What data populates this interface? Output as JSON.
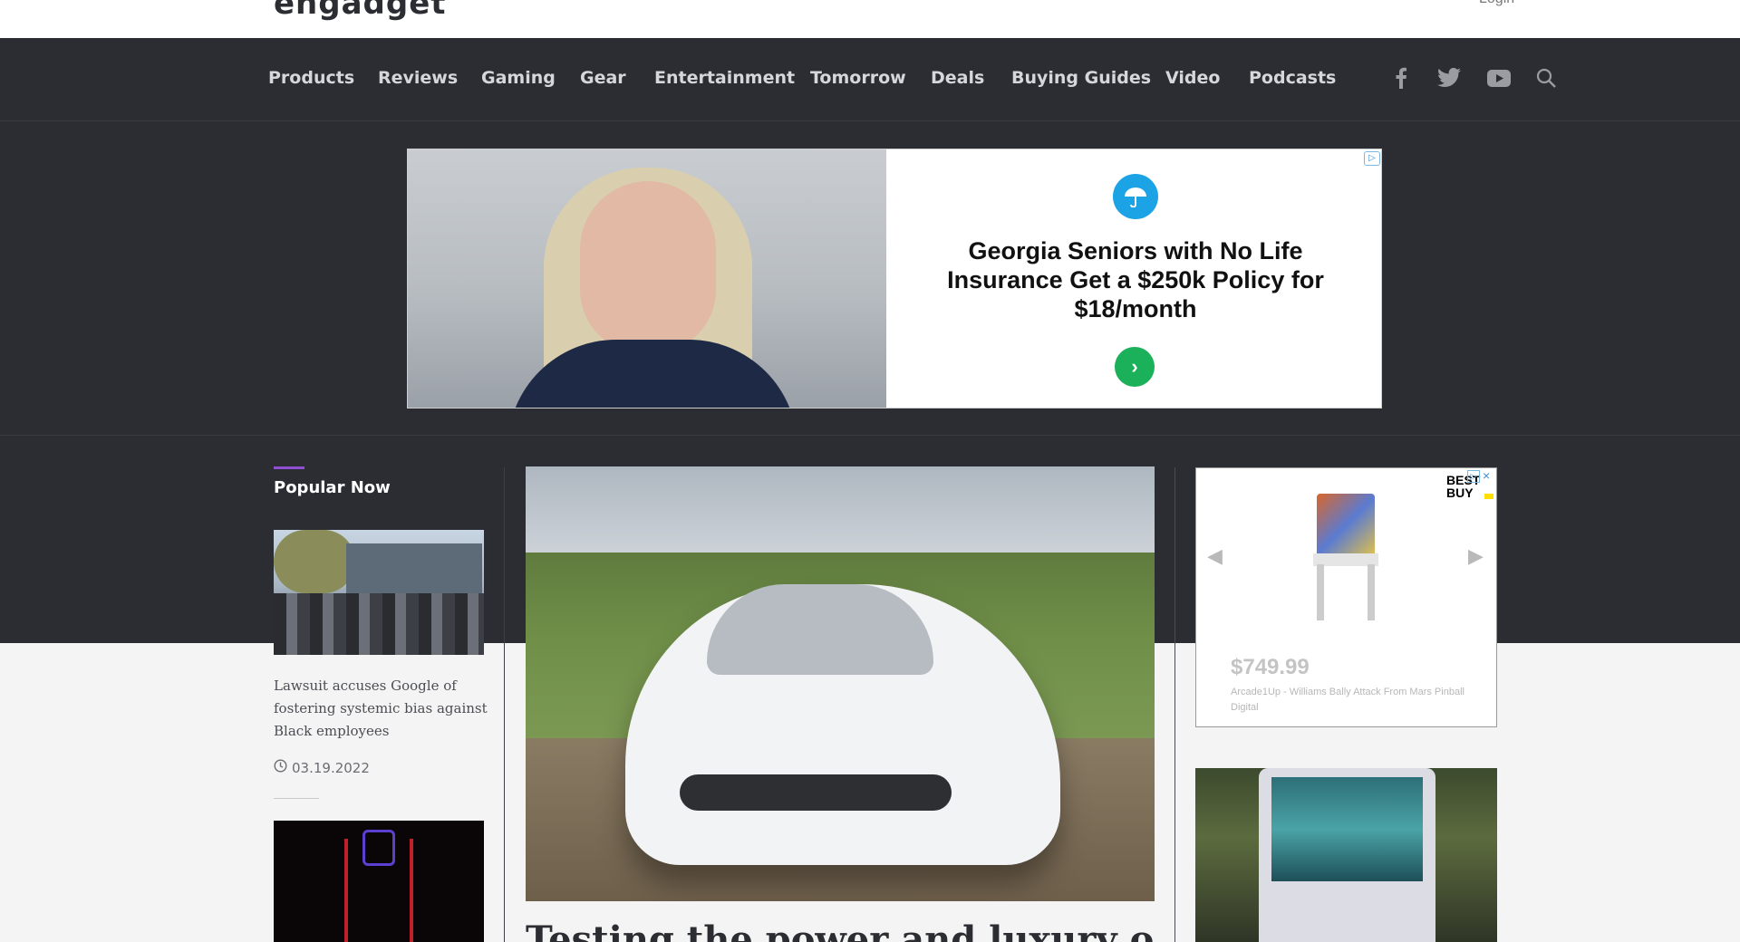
{
  "header": {
    "logo_text": "engadget",
    "login_label": "Login"
  },
  "nav": {
    "items": [
      {
        "label": "Products"
      },
      {
        "label": "Reviews"
      },
      {
        "label": "Gaming"
      },
      {
        "label": "Gear"
      },
      {
        "label": "Entertainment"
      },
      {
        "label": "Tomorrow"
      },
      {
        "label": "Deals"
      },
      {
        "label": "Buying Guides"
      },
      {
        "label": "Video"
      },
      {
        "label": "Podcasts"
      }
    ],
    "icons": [
      "facebook-icon",
      "twitter-icon",
      "youtube-icon",
      "search-icon"
    ]
  },
  "ad_banner": {
    "headline": "Georgia Seniors with No Life Insurance Get a $250k Policy for $18/month",
    "adchoices_glyph": "▷",
    "go_glyph": "›"
  },
  "popular": {
    "title": "Popular Now",
    "items": [
      {
        "headline": "Lawsuit accuses Google of fostering systemic bias against Black employees",
        "date": "03.19.2022"
      }
    ]
  },
  "hero": {
    "title": "Testing the power and luxury of"
  },
  "side_ad": {
    "brand": "BEST BUY",
    "price": "$749.99",
    "description": "Arcade1Up - Williams Bally Attack From Mars Pinball Digital",
    "prev_glyph": "◀",
    "next_glyph": "▶",
    "close_glyph": "×",
    "info_glyph": "▷"
  },
  "colors": {
    "nav_background": "#2b2d32",
    "accent_purple": "#8e4fd1",
    "ad_logo_blue": "#1ca3e6",
    "ad_go_green": "#1bb05a"
  }
}
